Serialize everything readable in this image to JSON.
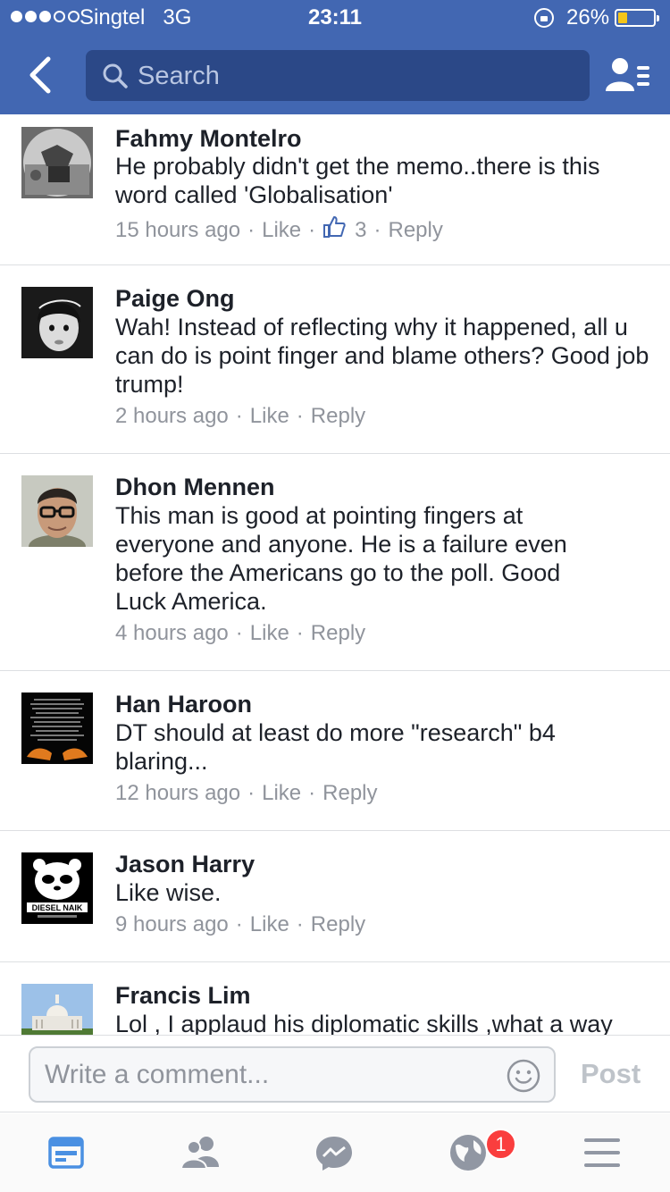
{
  "status_bar": {
    "carrier": "Singtel   3G",
    "time": "23:11",
    "battery_percent": "26%",
    "battery_level": 0.26,
    "signal_bars": 3
  },
  "nav": {
    "back_icon": "chevron-left-icon",
    "search_placeholder": "Search",
    "friends_icon": "friend-list-icon"
  },
  "colors": {
    "brand": "#4267b2",
    "search_bg": "#2b4887",
    "like_blue": "#4267b2",
    "meta_gray": "#90949c",
    "badge_red": "#fa3e3e"
  },
  "comments": [
    {
      "name": "Fahmy Montelro",
      "text": "He probably didn't get the memo..there is this word called 'Globalisation'",
      "time": "15 hours ago",
      "like_label": "Like",
      "reply_label": "Reply",
      "reactions": "3"
    },
    {
      "name": "Paige Ong",
      "text": "Wah! Instead of reflecting why it happened, all u can do is point finger and blame others? Good job trump!",
      "time": "2 hours ago",
      "like_label": "Like",
      "reply_label": "Reply"
    },
    {
      "name": "Dhon Mennen",
      "text": "This man is good at pointing fingers at everyone and anyone. He is a failure even before the Americans go to the poll. Good Luck America.",
      "time": "4 hours ago",
      "like_label": "Like",
      "reply_label": "Reply"
    },
    {
      "name": "Han Haroon",
      "text": "DT should at least do more \"research\" b4 blaring...",
      "time": "12 hours ago",
      "like_label": "Like",
      "reply_label": "Reply"
    },
    {
      "name": "Jason Harry",
      "text": "Like wise.",
      "time": "9 hours ago",
      "like_label": "Like",
      "reply_label": "Reply",
      "avatar_text": "DIESEL NAIK"
    },
    {
      "name": "Francis Lim",
      "text": "Lol , I applaud his diplomatic skills ,what a way"
    }
  ],
  "composer": {
    "placeholder": "Write a comment...",
    "post_label": "Post"
  },
  "tabbar": {
    "tabs": [
      "news-feed-icon",
      "friends-icon",
      "messenger-icon",
      "notifications-globe-icon",
      "menu-icon"
    ],
    "notification_badge": "1"
  }
}
